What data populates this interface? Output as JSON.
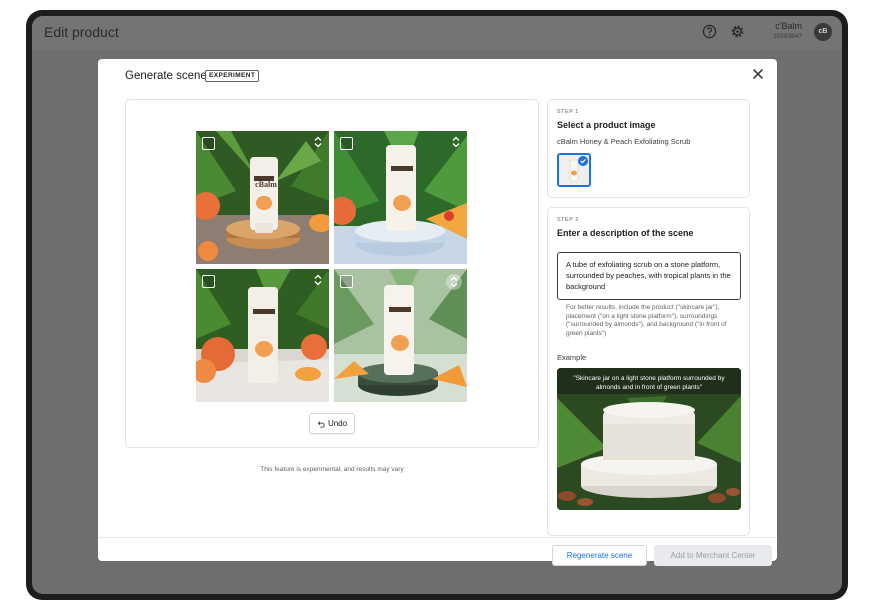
{
  "app": {
    "title": "Edit product",
    "account_name": "c'Balm",
    "account_id": "10293847",
    "avatar_text": "cB",
    "icons": {
      "help": "help-circle-icon",
      "settings": "gear-icon"
    }
  },
  "modal": {
    "title": "Generate scene",
    "badge": "EXPERIMENT",
    "close_icon": "close-icon",
    "undo_label": "Undo",
    "disclaimer": "This feature is experimental, and results may vary"
  },
  "step1": {
    "label": "STEP 1",
    "title": "Select a product image",
    "product_name": "cBalm Honey & Peach Exfoliating Scrub"
  },
  "step2": {
    "label": "STEP 2",
    "title": "Enter a description of the scene",
    "description_value": "A tube of exfoliating scrub on a stone platform, surrounded by peaches, with tropical plants in the background",
    "hint": "For better results, include the product (\"skincare jar\"), placement (\"on a light stone platform\"), surroundings (\"surrounded by almonds\"), and background (\"in front of green plants\")",
    "example_label": "Example",
    "example_caption": "\"Skincare jar on a light stone platform surrounded by almonds and in front of green plants\""
  },
  "tube_brand": "cBalm",
  "footer": {
    "regenerate_label": "Regenerate scene",
    "add_label": "Add to Merchant Center"
  },
  "colors": {
    "accent": "#1a73e8",
    "disabled_bg": "#e8eaed",
    "overlay": "#6e6e6e"
  }
}
